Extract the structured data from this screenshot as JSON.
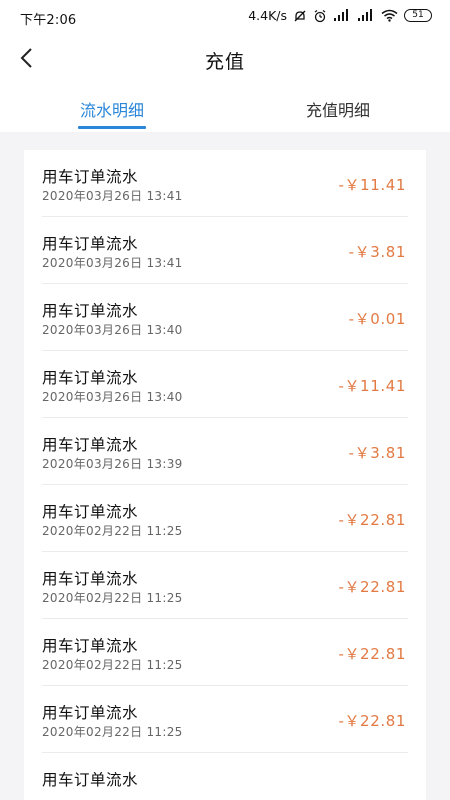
{
  "status_bar": {
    "time": "下午2:06",
    "network_speed": "4.4K/s",
    "battery": "51"
  },
  "header": {
    "title": "充值"
  },
  "tabs": [
    {
      "label": "流水明细",
      "active": true
    },
    {
      "label": "充值明细",
      "active": false
    }
  ],
  "transactions": [
    {
      "title": "用车订单流水",
      "date": "2020年03月26日 13:41",
      "amount": "-￥11.41"
    },
    {
      "title": "用车订单流水",
      "date": "2020年03月26日 13:41",
      "amount": "-￥3.81"
    },
    {
      "title": "用车订单流水",
      "date": "2020年03月26日 13:40",
      "amount": "-￥0.01"
    },
    {
      "title": "用车订单流水",
      "date": "2020年03月26日 13:40",
      "amount": "-￥11.41"
    },
    {
      "title": "用车订单流水",
      "date": "2020年03月26日 13:39",
      "amount": "-￥3.81"
    },
    {
      "title": "用车订单流水",
      "date": "2020年02月22日 11:25",
      "amount": "-￥22.81"
    },
    {
      "title": "用车订单流水",
      "date": "2020年02月22日 11:25",
      "amount": "-￥22.81"
    },
    {
      "title": "用车订单流水",
      "date": "2020年02月22日 11:25",
      "amount": "-￥22.81"
    },
    {
      "title": "用车订单流水",
      "date": "2020年02月22日 11:25",
      "amount": "-￥22.81"
    },
    {
      "title": "用车订单流水",
      "date": "",
      "amount": ""
    }
  ],
  "colors": {
    "accent": "#2a86d8",
    "amount": "#e27a43",
    "background": "#f4f4f6"
  },
  "icons": {
    "back": "back-chevron-icon"
  }
}
